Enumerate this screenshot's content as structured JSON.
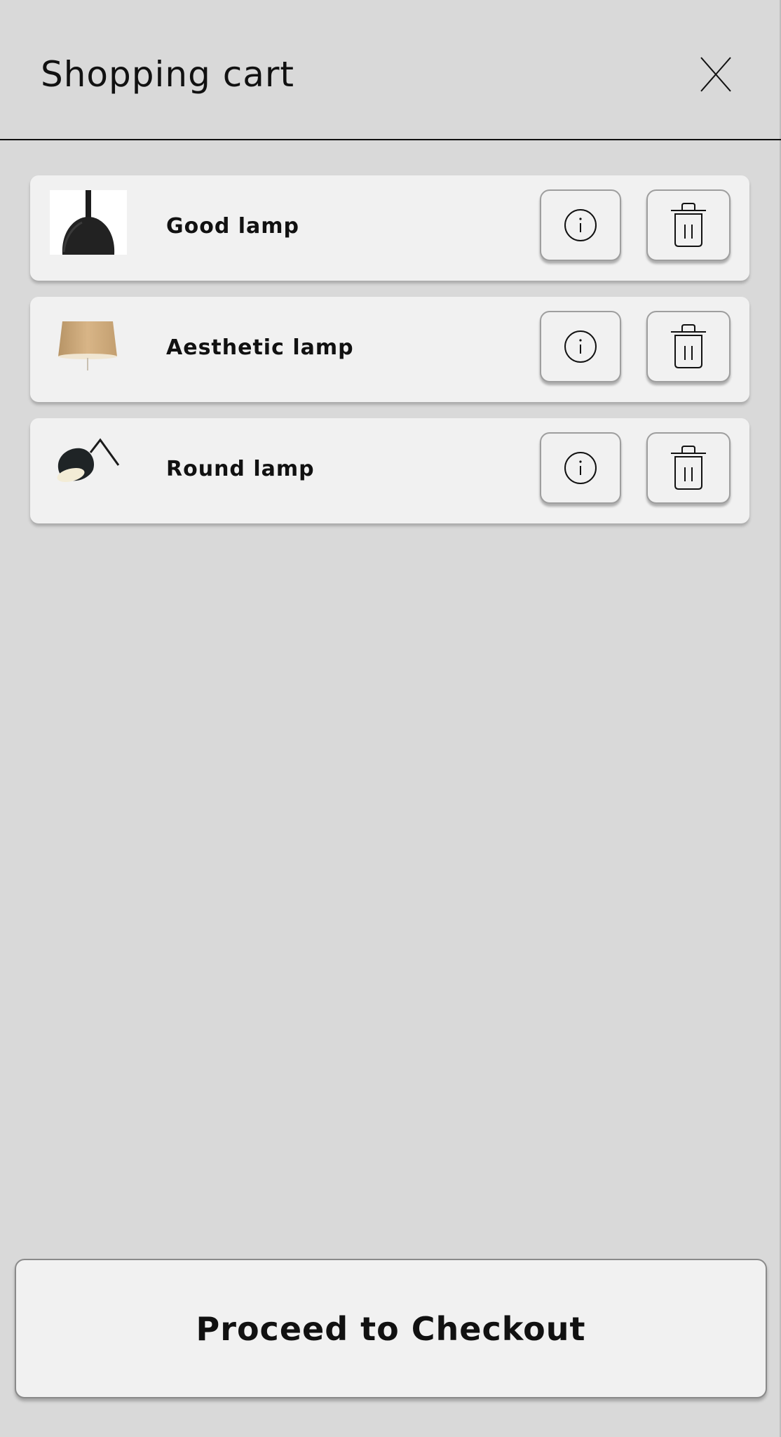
{
  "header": {
    "title": "Shopping cart",
    "close_icon": "close-icon"
  },
  "cart": {
    "items": [
      {
        "name": "Good lamp",
        "thumbnail": "pendant-lamp-image",
        "info_icon": "info-icon",
        "delete_icon": "trash-icon"
      },
      {
        "name": "Aesthetic lamp",
        "thumbnail": "shade-lamp-image",
        "info_icon": "info-icon",
        "delete_icon": "trash-icon"
      },
      {
        "name": "Round lamp",
        "thumbnail": "round-lamp-image",
        "info_icon": "info-icon",
        "delete_icon": "trash-icon"
      }
    ]
  },
  "checkout": {
    "label": "Proceed to Checkout"
  },
  "colors": {
    "background": "#d9d9d9",
    "card": "#f1f1f1",
    "text": "#111111"
  }
}
